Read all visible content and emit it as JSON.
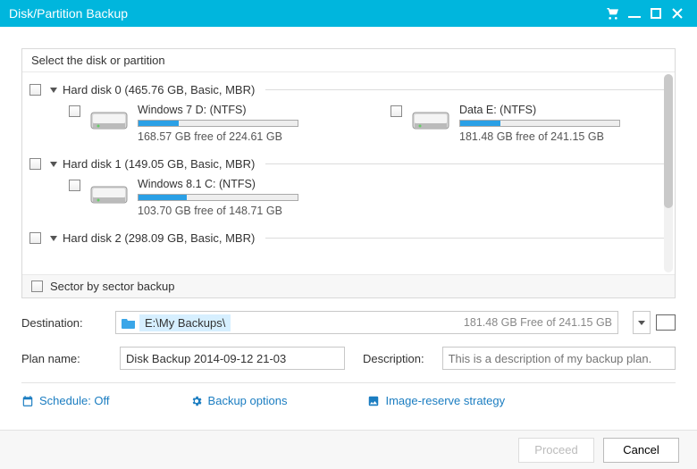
{
  "window": {
    "title": "Disk/Partition Backup"
  },
  "panel": {
    "header": "Select the disk or partition",
    "footer": "Sector by sector backup",
    "disks": [
      {
        "label": "Hard disk 0 (465.76 GB, Basic, MBR)",
        "partitions": [
          {
            "name": "Windows 7 D: (NTFS)",
            "free": "168.57 GB free of 224.61 GB"
          },
          {
            "name": "Data E: (NTFS)",
            "free": "181.48 GB free of 241.15 GB"
          }
        ]
      },
      {
        "label": "Hard disk 1 (149.05 GB, Basic, MBR)",
        "partitions": [
          {
            "name": "Windows 8.1 C: (NTFS)",
            "free": "103.70 GB free of 148.71 GB"
          }
        ]
      },
      {
        "label": "Hard disk 2 (298.09 GB, Basic, MBR)",
        "partitions": []
      }
    ]
  },
  "destination": {
    "label": "Destination:",
    "path": "E:\\My Backups\\",
    "free": "181.48 GB Free of 241.15 GB"
  },
  "plan": {
    "label": "Plan name:",
    "value": "Disk Backup 2014-09-12 21-03",
    "desc_label": "Description:",
    "desc_placeholder": "This is a description of my backup plan."
  },
  "opts": {
    "schedule": "Schedule: Off",
    "backup": "Backup options",
    "image": "Image-reserve strategy"
  },
  "buttons": {
    "proceed": "Proceed",
    "cancel": "Cancel"
  }
}
